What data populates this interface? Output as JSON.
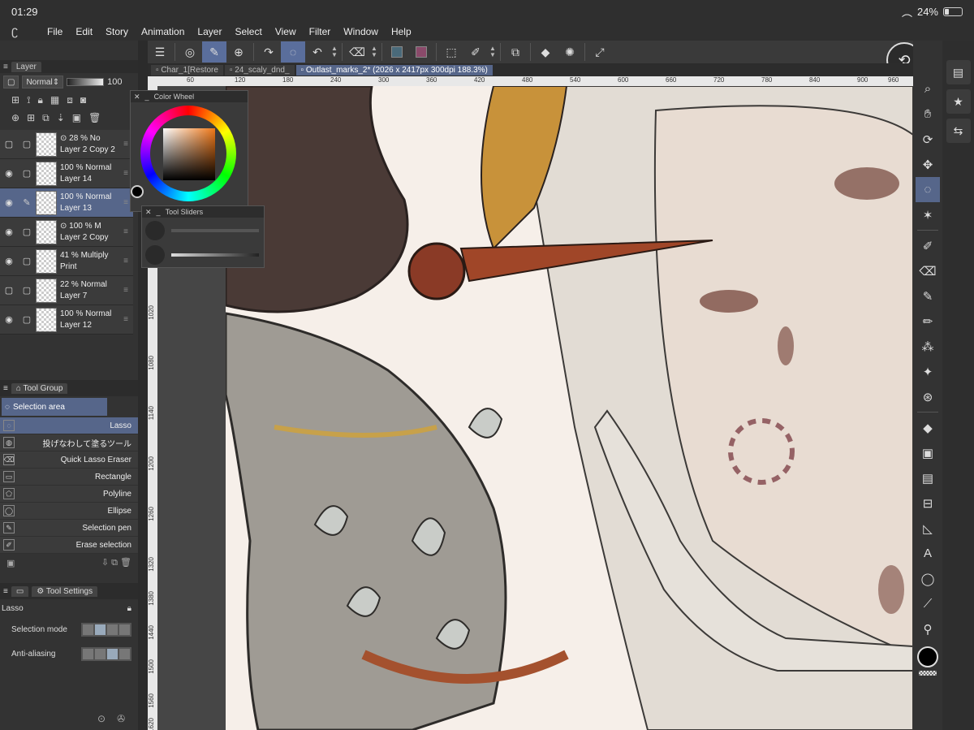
{
  "status": {
    "time": "01:29",
    "battery": "24%",
    "battery_level": 0.24
  },
  "menu": [
    "File",
    "Edit",
    "Story",
    "Animation",
    "Layer",
    "Select",
    "View",
    "Filter",
    "Window",
    "Help"
  ],
  "documents": [
    {
      "label": "Char_1[Restore",
      "active": false
    },
    {
      "label": "24_scaly_dnd_",
      "active": false
    },
    {
      "label": "Outlast_marks_2* (2026 x 2417px 300dpi 188.3%)",
      "active": true
    }
  ],
  "ruler": {
    "top_ticks": [
      "60",
      "120",
      "180",
      "240",
      "300",
      "360",
      "420",
      "480",
      "540",
      "600",
      "660",
      "720",
      "780",
      "840",
      "900",
      "960"
    ],
    "left_ticks": [
      "960",
      "1020",
      "1080",
      "1140",
      "1200",
      "1260",
      "1320",
      "1380",
      "1440",
      "1500",
      "1560",
      "1620"
    ]
  },
  "layer_panel": {
    "title": "Layer",
    "blend_mode": "Normal",
    "opacity": "100",
    "layers": [
      {
        "opacity": "28 %",
        "mode": "No",
        "name": "Layer 2 Copy 2",
        "visible": false,
        "selected": false
      },
      {
        "opacity": "100 %",
        "mode": "Normal",
        "name": "Layer 14",
        "visible": true,
        "selected": false
      },
      {
        "opacity": "100 %",
        "mode": "Normal",
        "name": "Layer 13",
        "visible": true,
        "selected": true
      },
      {
        "opacity": "100 %",
        "mode": "M",
        "name": "Layer 2 Copy",
        "visible": true,
        "selected": false
      },
      {
        "opacity": "41 %",
        "mode": "Multiply",
        "name": "Print",
        "visible": true,
        "selected": false
      },
      {
        "opacity": "22 %",
        "mode": "Normal",
        "name": "Layer 7",
        "visible": false,
        "selected": false
      },
      {
        "opacity": "100 %",
        "mode": "Normal",
        "name": "Layer 12",
        "visible": true,
        "selected": false
      }
    ]
  },
  "tool_group": {
    "title": "Tool Group",
    "current": "Selection area",
    "tools": [
      {
        "label": "Lasso",
        "icon": "lasso-icon",
        "selected": true
      },
      {
        "label": "投げなわして塗るツール",
        "icon": "lasso-fill-icon",
        "selected": false
      },
      {
        "label": "Quick Lasso Eraser",
        "icon": "eraser-icon",
        "selected": false
      },
      {
        "label": "Rectangle",
        "icon": "rectangle-icon",
        "selected": false
      },
      {
        "label": "Polyline",
        "icon": "polyline-icon",
        "selected": false
      },
      {
        "label": "Ellipse",
        "icon": "ellipse-icon",
        "selected": false
      },
      {
        "label": "Selection pen",
        "icon": "selection-pen-icon",
        "selected": false
      },
      {
        "label": "Erase selection",
        "icon": "erase-selection-icon",
        "selected": false
      }
    ]
  },
  "tool_settings": {
    "title": "Tool Settings",
    "tool_name": "Lasso",
    "selection_mode_label": "Selection mode",
    "anti_aliasing_label": "Anti-aliasing"
  },
  "color_wheel": {
    "title": "Color Wheel",
    "main_color": "#000000",
    "hue_color": "#f07818"
  },
  "tool_sliders": {
    "title": "Tool Sliders"
  },
  "colors": {
    "accent": "#56668a",
    "panel": "#333333",
    "canvas_bg": "#464646"
  }
}
